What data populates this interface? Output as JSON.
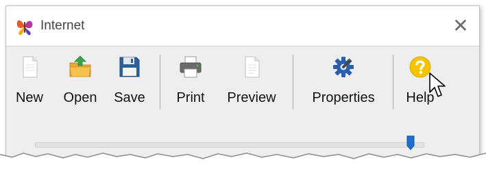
{
  "window": {
    "title": "Internet",
    "app_icon": "butterfly-app-icon",
    "close_glyph": "✕"
  },
  "toolbar": {
    "buttons": [
      {
        "label": "New",
        "icon": "new-document-icon"
      },
      {
        "label": "Open",
        "icon": "open-folder-icon"
      },
      {
        "label": "Save",
        "icon": "floppy-disk-icon"
      },
      {
        "label": "Print",
        "icon": "printer-icon"
      },
      {
        "label": "Preview",
        "icon": "preview-document-icon"
      },
      {
        "label": "Properties",
        "icon": "gear-wrench-icon"
      },
      {
        "label": "Help",
        "icon": "question-mark-icon"
      }
    ]
  },
  "slider": {
    "value_fraction": 0.97,
    "accent": "#1e6fd0"
  },
  "colors": {
    "toolbar_background": "#eeeeee",
    "help_icon": "#f5c400",
    "properties_icon": "#2a5fb0"
  }
}
